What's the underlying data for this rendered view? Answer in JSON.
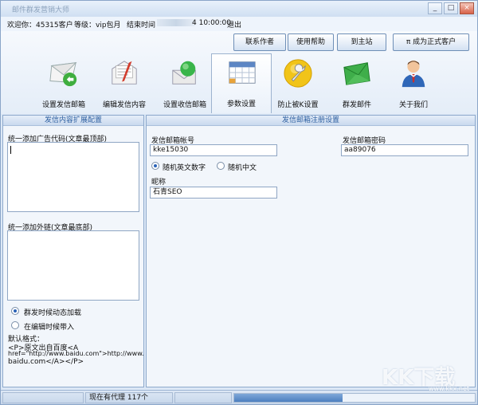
{
  "window": {
    "title": "邮件群发营销大师",
    "controls": {
      "minimize": "_",
      "maximize": "□",
      "close": "×"
    }
  },
  "info": {
    "welcome": "欢迎你：45315客户",
    "level": "等级：vip包月",
    "expires_label": "结束时间",
    "expires_suffix": "4 10:00:00",
    "logout": "退出"
  },
  "toolbar": {
    "buttons": [
      {
        "label": "联系作者"
      },
      {
        "label": "使用帮助"
      },
      {
        "label": "到主站"
      },
      {
        "label": "π 成为正式客户"
      }
    ]
  },
  "nav": {
    "items": [
      {
        "label": "设置发信邮箱",
        "icon": "envelope-send-icon"
      },
      {
        "label": "编辑发信内容",
        "icon": "letter-edit-icon"
      },
      {
        "label": "设置收信邮箱",
        "icon": "mail-receive-icon"
      },
      {
        "label": "参数设置",
        "icon": "calendar-grid-icon"
      },
      {
        "label": "防止被K设置",
        "icon": "wrench-icon"
      },
      {
        "label": "群发邮件",
        "icon": "green-envelope-icon"
      },
      {
        "label": "关于我们",
        "icon": "user-avatar-icon"
      }
    ],
    "active_index": 3
  },
  "left": {
    "header": "发信内容扩展配置",
    "ad_label": "统一添加广告代码(文章最顶部)",
    "link_label": "统一添加外链(文章最底部)",
    "radio1": "群发时候动态加载",
    "radio2": "在编辑时候带入",
    "default_label": "默认格式：",
    "default_line1": "<P>原文出自百度<A",
    "default_line2": "href=\"http://www.baidu.com\">http://www.",
    "default_line3": "baidu.com</A></P>"
  },
  "right": {
    "header": "发信邮箱注册设置",
    "account_label": "发信邮箱帐号",
    "account_value": "kke15030",
    "password_label": "发信邮箱密码",
    "password_value": "aa89076",
    "radio_en": "随机英文数字",
    "radio_cn": "随机中文",
    "nickname_label": "昵称",
    "nickname_value": "石青SEO"
  },
  "status": {
    "proxy_text": "现在有代理 117个",
    "progress": 0.45
  },
  "watermark": {
    "big": "KK下载",
    "small": "www.kkx.net"
  },
  "colors": {
    "accent": "#2d5fa0",
    "panel_bg": "#f2f6fb",
    "border": "#8da9cc"
  }
}
